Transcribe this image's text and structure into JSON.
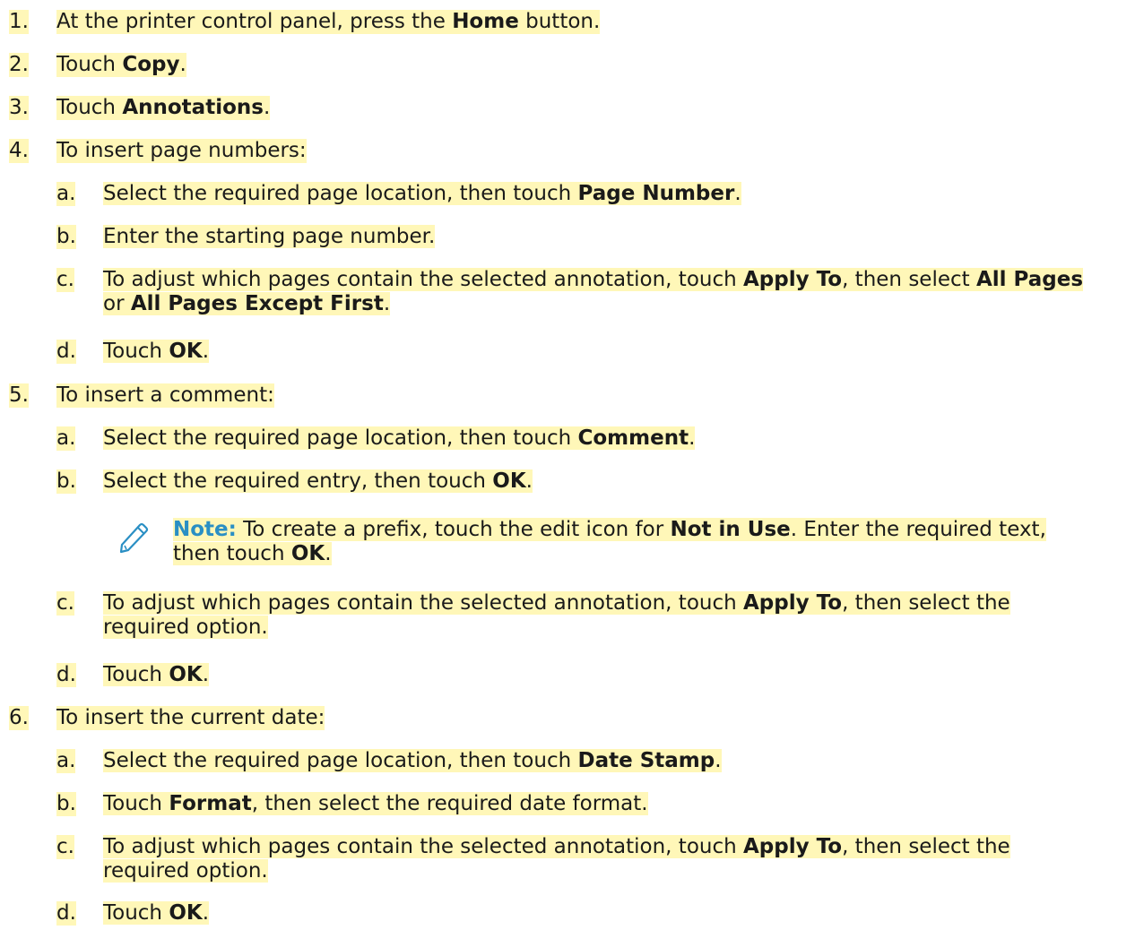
{
  "steps": [
    {
      "num": "1.",
      "parts": [
        {
          "t": "At the printer control panel, press the "
        },
        {
          "t": "Home",
          "b": true
        },
        {
          "t": " button."
        }
      ]
    },
    {
      "num": "2.",
      "parts": [
        {
          "t": "Touch "
        },
        {
          "t": "Copy",
          "b": true
        },
        {
          "t": "."
        }
      ]
    },
    {
      "num": "3.",
      "parts": [
        {
          "t": "Touch "
        },
        {
          "t": "Annotations",
          "b": true
        },
        {
          "t": "."
        }
      ]
    },
    {
      "num": "4.",
      "parts": [
        {
          "t": "To insert page numbers:"
        }
      ],
      "sub": [
        {
          "num": "a.",
          "lines": [
            [
              {
                "t": "Select the required page location, then touch "
              },
              {
                "t": "Page Number",
                "b": true
              },
              {
                "t": "."
              }
            ]
          ]
        },
        {
          "num": "b.",
          "lines": [
            [
              {
                "t": "Enter the starting page number."
              }
            ]
          ]
        },
        {
          "num": "c.",
          "lines": [
            [
              {
                "t": "To adjust which pages contain the selected annotation, touch "
              },
              {
                "t": "Apply To",
                "b": true
              },
              {
                "t": ", then select "
              },
              {
                "t": "All Pages",
                "b": true
              }
            ],
            [
              {
                "t": "or "
              },
              {
                "t": "All Pages Except First",
                "b": true
              },
              {
                "t": "."
              }
            ]
          ]
        },
        {
          "num": "d.",
          "lines": [
            [
              {
                "t": "Touch "
              },
              {
                "t": "OK",
                "b": true
              },
              {
                "t": "."
              }
            ]
          ]
        }
      ]
    },
    {
      "num": "5.",
      "parts": [
        {
          "t": "To insert a comment:"
        }
      ],
      "sub": [
        {
          "num": "a.",
          "lines": [
            [
              {
                "t": "Select the required page location, then touch "
              },
              {
                "t": "Comment",
                "b": true
              },
              {
                "t": "."
              }
            ]
          ]
        },
        {
          "num": "b.",
          "lines": [
            [
              {
                "t": "Select the required entry, then touch "
              },
              {
                "t": "OK",
                "b": true
              },
              {
                "t": "."
              }
            ]
          ]
        },
        {
          "num": "c.",
          "lines": [
            [
              {
                "t": "To adjust which pages contain the selected annotation, touch "
              },
              {
                "t": "Apply To",
                "b": true
              },
              {
                "t": ", then select the"
              }
            ],
            [
              {
                "t": "required option."
              }
            ]
          ]
        },
        {
          "num": "d.",
          "lines": [
            [
              {
                "t": "Touch "
              },
              {
                "t": "OK",
                "b": true
              },
              {
                "t": "."
              }
            ]
          ]
        }
      ],
      "note": {
        "label": "Note:",
        "lines": [
          [
            {
              "t": " To create a prefix, touch the edit icon for "
            },
            {
              "t": "Not in Use",
              "b": true
            },
            {
              "t": ". Enter the required text,"
            }
          ],
          [
            {
              "t": "then touch "
            },
            {
              "t": "OK",
              "b": true
            },
            {
              "t": "."
            }
          ]
        ]
      }
    },
    {
      "num": "6.",
      "parts": [
        {
          "t": "To insert the current date:"
        }
      ],
      "sub": [
        {
          "num": "a.",
          "lines": [
            [
              {
                "t": "Select the required page location, then touch "
              },
              {
                "t": "Date Stamp",
                "b": true
              },
              {
                "t": "."
              }
            ]
          ]
        },
        {
          "num": "b.",
          "lines": [
            [
              {
                "t": "Touch "
              },
              {
                "t": "Format",
                "b": true
              },
              {
                "t": ", then select the required date format."
              }
            ]
          ]
        },
        {
          "num": "c.",
          "lines": [
            [
              {
                "t": "To adjust which pages contain the selected annotation, touch "
              },
              {
                "t": "Apply To",
                "b": true
              },
              {
                "t": ", then select the"
              }
            ],
            [
              {
                "t": "required option."
              }
            ]
          ]
        },
        {
          "num": "d.",
          "lines": [
            [
              {
                "t": "Touch "
              },
              {
                "t": "OK",
                "b": true
              },
              {
                "t": "."
              }
            ]
          ]
        }
      ]
    }
  ],
  "icons": {
    "note": "pencil-edit-icon"
  },
  "colors": {
    "highlight": "#fff7b8",
    "note_label": "#2a8fc4",
    "text": "#1a1a1a"
  }
}
